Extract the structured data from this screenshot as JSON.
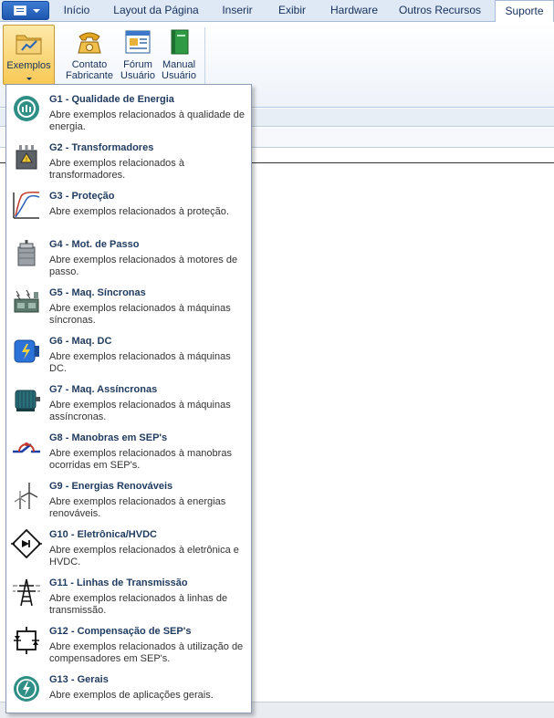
{
  "tabs": [
    {
      "label": "Início"
    },
    {
      "label": "Layout da Página"
    },
    {
      "label": "Inserir"
    },
    {
      "label": "Exibir"
    },
    {
      "label": "Hardware"
    },
    {
      "label": "Outros Recursos"
    },
    {
      "label": "Suporte"
    }
  ],
  "active_tab": "Suporte",
  "ribbon": {
    "exemplos": {
      "label": "Exemplos",
      "icon": "folder-chart-icon"
    },
    "contato": {
      "label_line1": "Contato",
      "label_line2": "Fabricante",
      "icon": "telephone-icon"
    },
    "forum": {
      "label_line1": "Fórum",
      "label_line2": "Usuário",
      "icon": "forum-window-icon"
    },
    "manual": {
      "label_line1": "Manual",
      "label_line2": "Usuário",
      "icon": "green-book-icon"
    }
  },
  "menu": {
    "items": [
      {
        "title": "G1 - Qualidade de Energia",
        "desc": "Abre exemplos relacionados à qualidade de energia.",
        "icon": "power-quality-icon"
      },
      {
        "title": "G2 - Transformadores",
        "desc": "Abre exemplos relacionados à transformadores.",
        "icon": "transformer-icon"
      },
      {
        "title": "G3 - Proteção",
        "desc": "Abre exemplos relacionados à proteção.",
        "icon": "protection-curve-icon"
      },
      {
        "title": "G4 - Mot. de Passo",
        "desc": "Abre exemplos relacionados à motores de passo.",
        "icon": "stepper-motor-icon"
      },
      {
        "title": "G5 - Maq. Síncronas",
        "desc": "Abre exemplos relacionados à máquinas síncronas.",
        "icon": "synchronous-machine-icon"
      },
      {
        "title": "G6 - Maq. DC",
        "desc": "Abre exemplos relacionados à máquinas DC.",
        "icon": "dc-machine-icon"
      },
      {
        "title": "G7 - Maq. Assíncronas",
        "desc": "Abre exemplos relacionados à máquinas assíncronas.",
        "icon": "induction-motor-icon"
      },
      {
        "title": "G8 - Manobras em SEP's",
        "desc": "Abre exemplos relacionados à manobras ocorridas em SEP's.",
        "icon": "switching-icon"
      },
      {
        "title": "G9 - Energias Renováveis",
        "desc": "Abre exemplos relacionados à energias renováveis.",
        "icon": "wind-turbine-icon"
      },
      {
        "title": "G10 - Eletrônica/HVDC",
        "desc": "Abre exemplos relacionados à eletrônica e HVDC.",
        "icon": "diode-bridge-icon"
      },
      {
        "title": "G11 - Linhas de Transmissão",
        "desc": "Abre exemplos relacionados à linhas de transmissão.",
        "icon": "transmission-tower-icon"
      },
      {
        "title": "G12 - Compensação de SEP's",
        "desc": "Abre exemplos relacionados à utilização de compensadores em SEP's.",
        "icon": "thyristor-compensator-icon"
      },
      {
        "title": "G13 - Gerais",
        "desc": "Abre exemplos de aplicações gerais.",
        "icon": "general-lightning-icon"
      }
    ]
  },
  "colors": {
    "accent": "#1d57ad",
    "menu_title": "#1f3a5f",
    "pressed": "#f8c955"
  }
}
